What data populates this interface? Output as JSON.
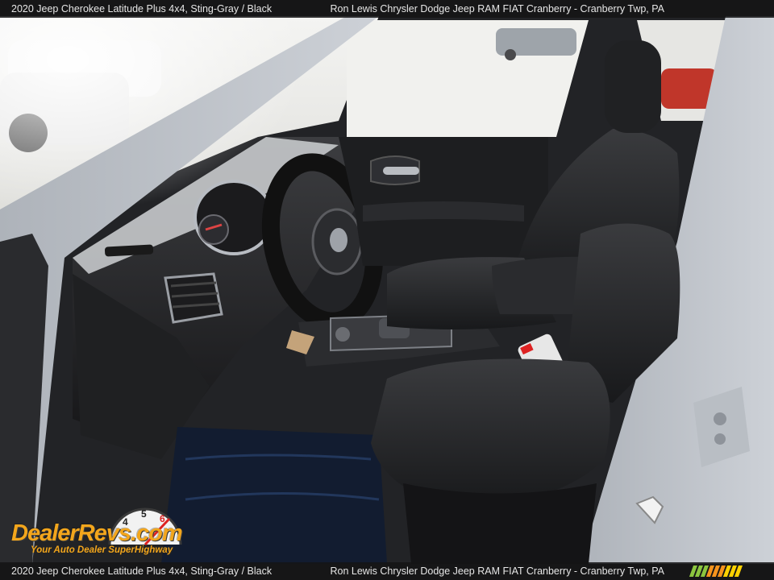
{
  "caption": {
    "vehicle": "2020 Jeep Cherokee Latitude Plus 4x4,  Sting-Gray / Black",
    "dealer": "Ron Lewis Chrysler Dodge Jeep RAM FIAT Cranberry - Cranberry Twp, PA"
  },
  "watermark": {
    "brand": "DealerRevs.com",
    "tagline": "Your Auto Dealer SuperHighway",
    "gauge_numbers": [
      "4",
      "5",
      "6"
    ]
  },
  "colors": {
    "accent": "#f3a61c",
    "caption_bg": "#141416",
    "stripe_green": "#8cc63f",
    "stripe_orange": "#f7941d",
    "stripe_yellow": "#ffd200"
  }
}
